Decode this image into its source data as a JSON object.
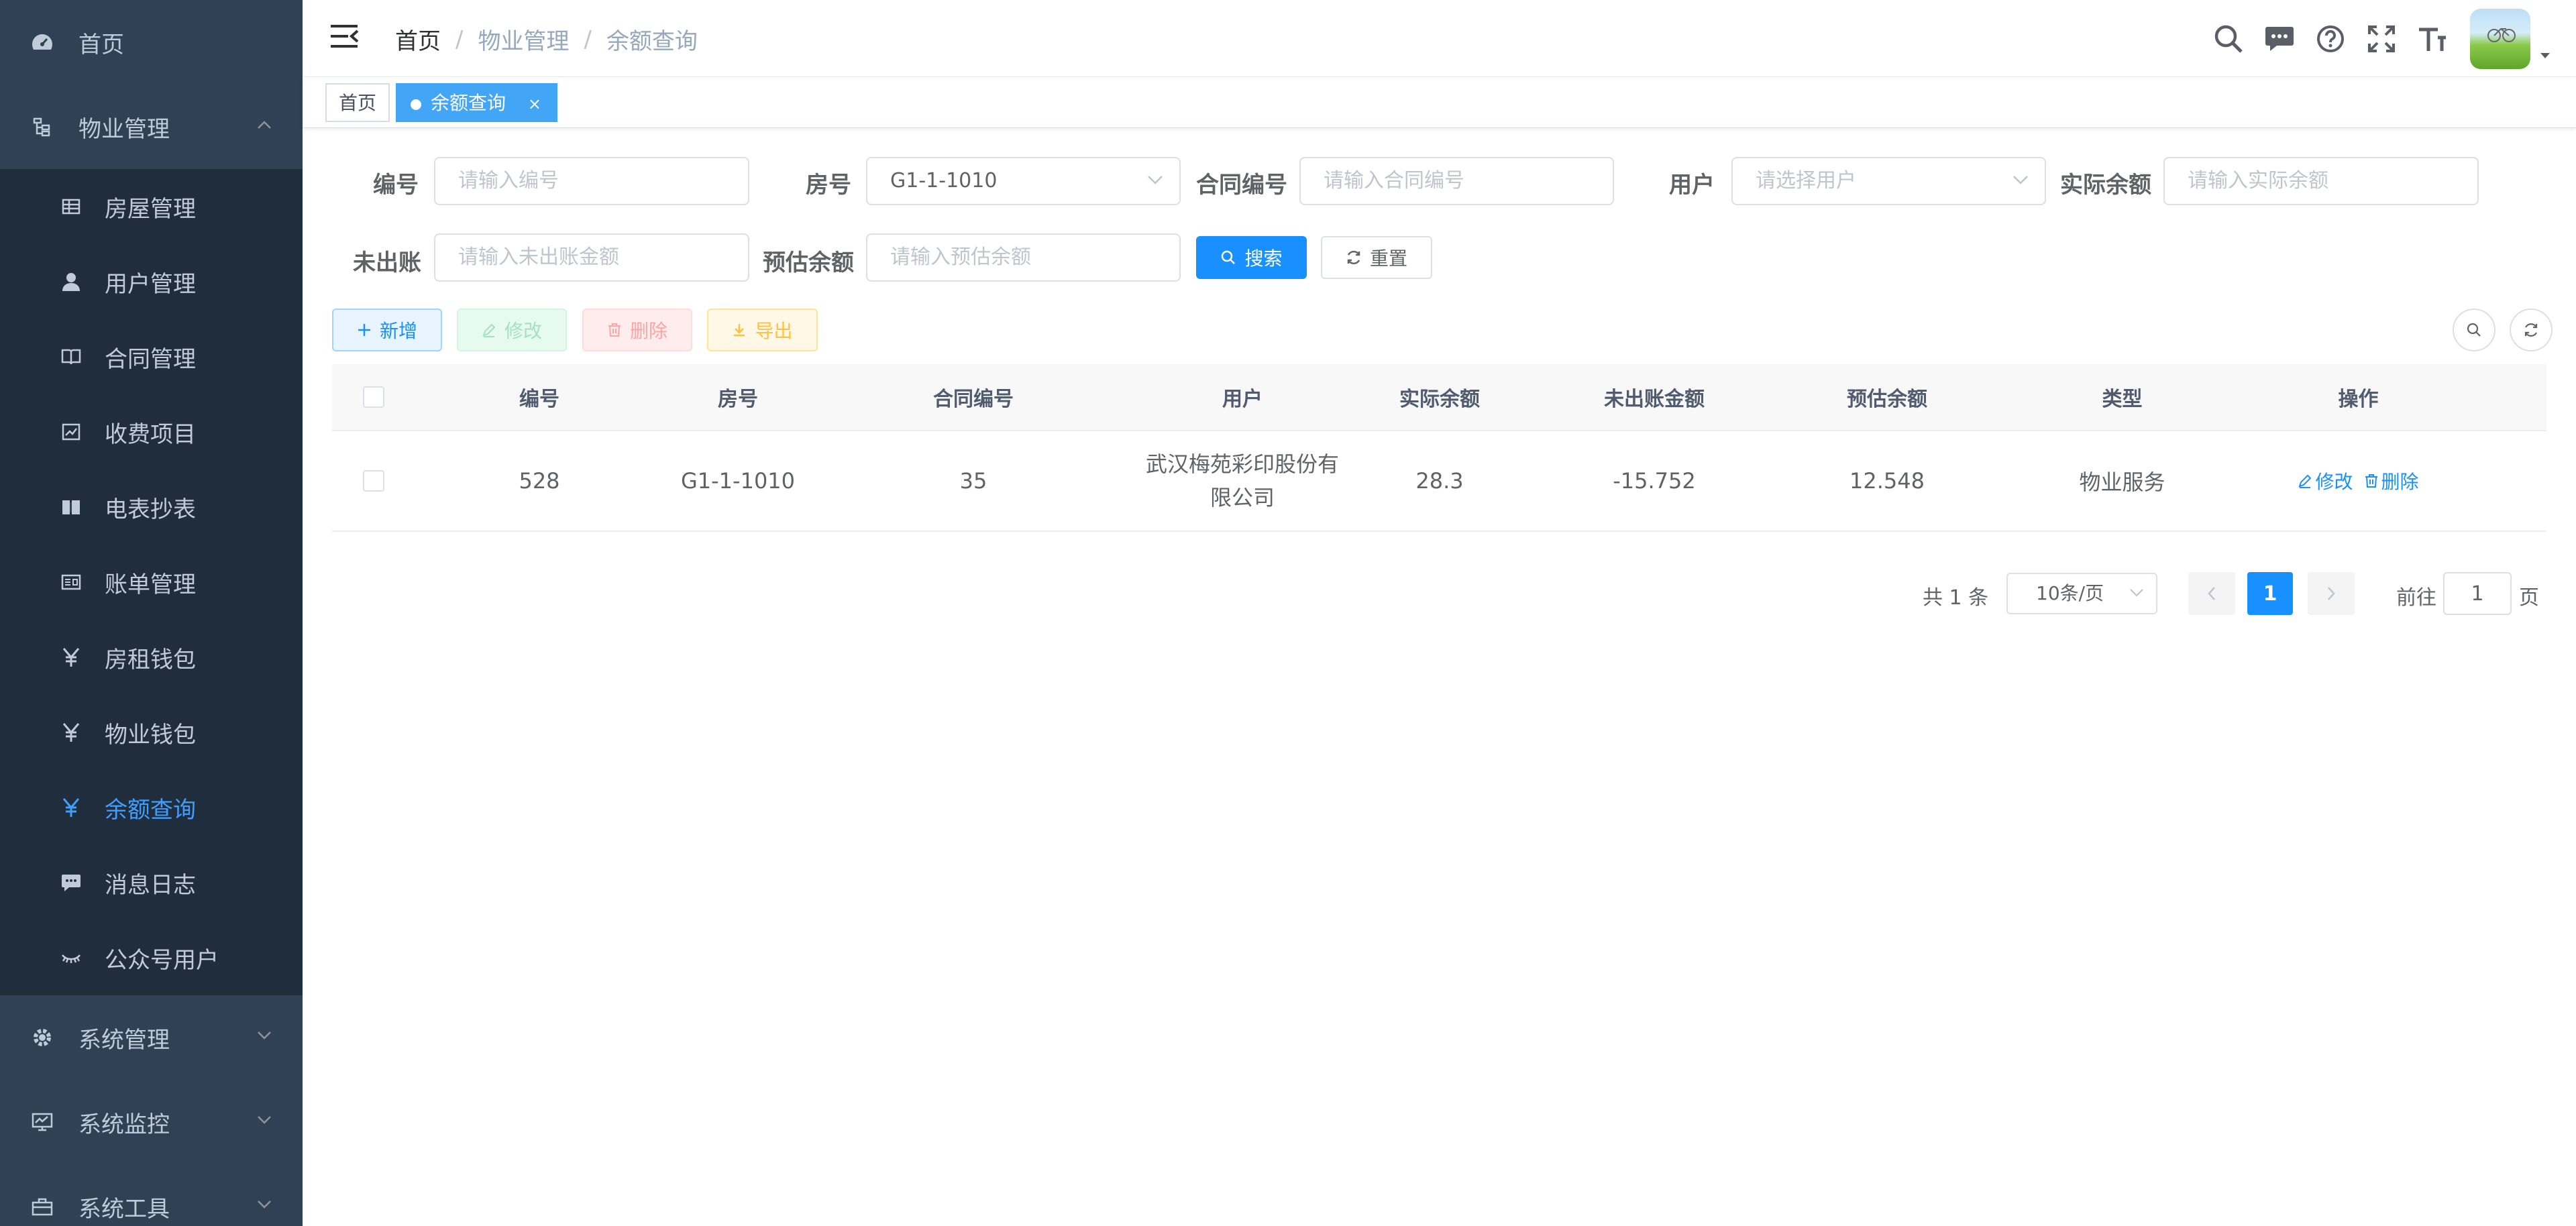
{
  "sidebar": {
    "top_items": [
      {
        "label": "首页",
        "icon": "dashboard-icon"
      },
      {
        "label": "物业管理",
        "icon": "tree-icon",
        "expanded": true
      }
    ],
    "sub_items": [
      {
        "label": "房屋管理",
        "icon": "table-icon"
      },
      {
        "label": "用户管理",
        "icon": "user-icon"
      },
      {
        "label": "合同管理",
        "icon": "book-icon"
      },
      {
        "label": "收费项目",
        "icon": "chart-icon"
      },
      {
        "label": "电表抄表",
        "icon": "education-icon"
      },
      {
        "label": "账单管理",
        "icon": "form-icon"
      },
      {
        "label": "房租钱包",
        "icon": "yen-icon"
      },
      {
        "label": "物业钱包",
        "icon": "yen-icon"
      },
      {
        "label": "余额查询",
        "icon": "yen-icon",
        "active": true
      },
      {
        "label": "消息日志",
        "icon": "message-icon"
      },
      {
        "label": "公众号用户",
        "icon": "eye-closed-icon"
      }
    ],
    "bottom_items": [
      {
        "label": "系统管理",
        "icon": "gear-icon"
      },
      {
        "label": "系统监控",
        "icon": "monitor-icon"
      },
      {
        "label": "系统工具",
        "icon": "toolbox-icon"
      }
    ],
    "colors": {
      "bg": "#304156",
      "sub_bg": "#1f2d3d",
      "text": "#bfcbd9",
      "active": "#409eff"
    }
  },
  "navbar": {
    "breadcrumb": [
      "首页",
      "物业管理",
      "余额查询"
    ],
    "separator": "/"
  },
  "tags": {
    "home": "首页",
    "active": "余额查询",
    "close": "×"
  },
  "filters": {
    "code_label": "编号",
    "code_placeholder": "请输入编号",
    "room_label": "房号",
    "room_value": "G1-1-1010",
    "contract_label": "合同编号",
    "contract_placeholder": "请输入合同编号",
    "user_label": "用户",
    "user_placeholder": "请选择用户",
    "actual_label": "实际余额",
    "actual_placeholder": "请输入实际余额",
    "unbilled_label": "未出账",
    "unbilled_placeholder": "请输入未出账金额",
    "estimated_label": "预估余额",
    "estimated_placeholder": "请输入预估余额",
    "search_label": "搜索",
    "reset_label": "重置"
  },
  "toolbar": {
    "add_label": "新增",
    "edit_label": "修改",
    "delete_label": "删除",
    "export_label": "导出"
  },
  "table": {
    "headers": [
      "编号",
      "房号",
      "合同编号",
      "用户",
      "实际余额",
      "未出账金额",
      "预估余额",
      "类型",
      "操作"
    ],
    "rows": [
      {
        "code": "528",
        "room": "G1-1-1010",
        "contract": "35",
        "user_line1": "武汉梅苑彩印股份有",
        "user_line2": "限公司",
        "actual": "28.3",
        "unbilled": "-15.752",
        "estimated": "12.548",
        "type": "物业服务",
        "edit": "修改",
        "delete": "删除"
      }
    ]
  },
  "pagination": {
    "total": "共 1 条",
    "page_size": "10条/页",
    "current_page": "1",
    "goto_label": "前往",
    "goto_value": "1",
    "page_suffix": "页"
  },
  "colors": {
    "primary": "#1890ff",
    "accent": "#42a5f5"
  }
}
